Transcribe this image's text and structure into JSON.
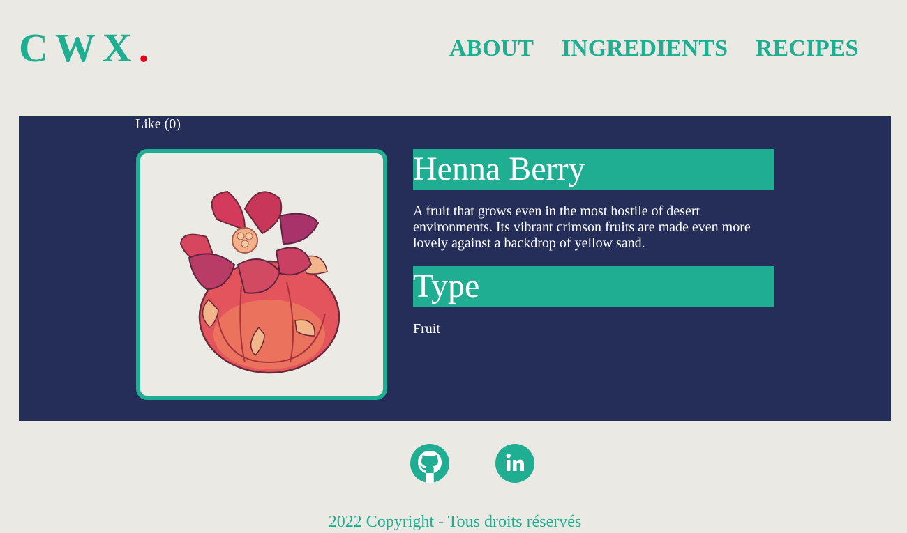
{
  "header": {
    "logo_text": "CWX",
    "logo_dot": ".",
    "nav": {
      "about": "ABOUT",
      "ingredients": "INGREDIENTS",
      "recipes": "RECIPES"
    }
  },
  "ingredient": {
    "like_label": "Like (0)",
    "name": "Henna Berry",
    "description": "A fruit that grows even in the most hostile of desert environments. Its vibrant crimson fruits are made even more lovely against a backdrop of yellow sand.",
    "type_heading": "Type",
    "type_value": "Fruit",
    "image_icon": "henna-berry-image"
  },
  "footer": {
    "github_icon": "github-icon",
    "linkedin_icon": "linkedin-icon",
    "copyright": "2022 Copyright - Tous droits réservés"
  },
  "colors": {
    "accent": "#20ae93",
    "panel": "#242e58",
    "background": "#eae9e4",
    "logo_dot": "#e3001b"
  }
}
